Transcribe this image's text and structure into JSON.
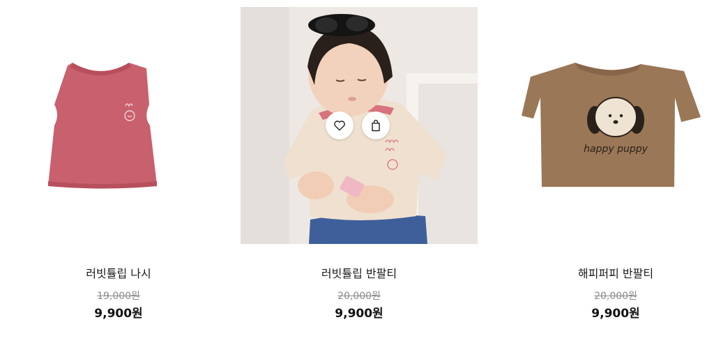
{
  "products": [
    {
      "name": "러빗튤립 나시",
      "original_price": "19,000원",
      "sale_price": "9,900원",
      "image_label": "pink sleeveless top with tulip embroidery",
      "image_colors": {
        "fabric": "#c9606d",
        "fabric_dark": "#b84f5c"
      }
    },
    {
      "name": "러빗튤립 반팔티",
      "original_price": "20,000원",
      "sale_price": "9,900원",
      "image_label": "child wearing cream tee with pink collar",
      "image_colors": {
        "wall": "#ede8e3",
        "shirt": "#efe0cf",
        "collar": "#d8727c",
        "jeans": "#3e5f9a"
      }
    },
    {
      "name": "해피퍼피 반팔티",
      "original_price": "20,000원",
      "sale_price": "9,900원",
      "image_label": "brown tee with puppy print",
      "print_text": "happy puppy",
      "image_colors": {
        "fabric": "#9a7756",
        "fabric_dark": "#876549",
        "ink": "#2a211a"
      }
    }
  ],
  "hover_actions": {
    "like_icon": "heart-icon",
    "cart_icon": "shopping-bag-icon"
  }
}
